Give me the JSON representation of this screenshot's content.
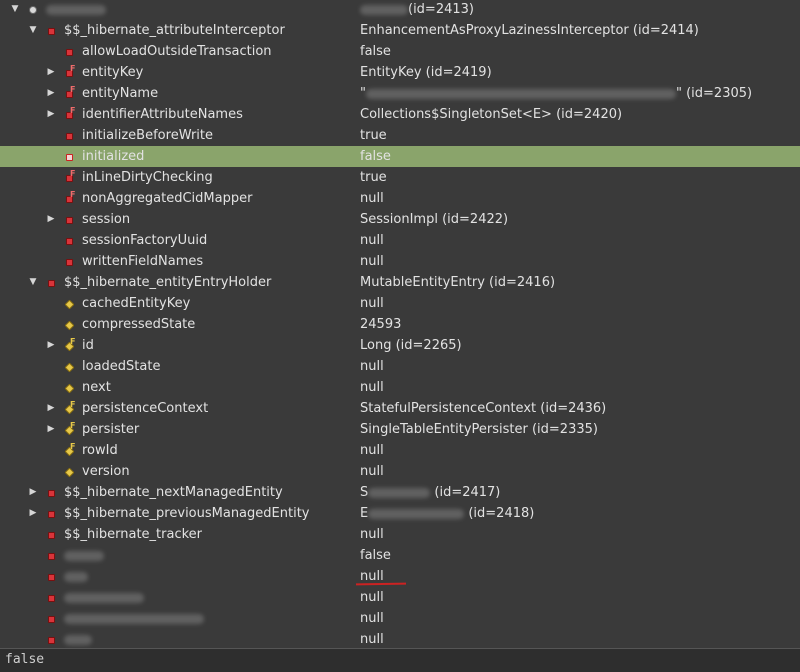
{
  "rows": [
    {
      "indent": 0,
      "arrow": "down",
      "icon": "gray",
      "name": "",
      "name_blur": 60,
      "value": "(id=2413)",
      "value_prefix_blur": 48,
      "selected": false
    },
    {
      "indent": 1,
      "arrow": "down",
      "icon": "red",
      "name": "$$_hibernate_attributeInterceptor",
      "value": "EnhancementAsProxyLazinessInterceptor  (id=2414)"
    },
    {
      "indent": 2,
      "arrow": "none",
      "icon": "red",
      "name": "allowLoadOutsideTransaction",
      "value": "false"
    },
    {
      "indent": 2,
      "arrow": "right",
      "icon": "red-final",
      "name": "entityKey",
      "value": "EntityKey  (id=2419)"
    },
    {
      "indent": 2,
      "arrow": "right",
      "icon": "red-final",
      "name": "entityName",
      "value": "\"",
      "value_blur": 310,
      "value_suffix": "\" (id=2305)"
    },
    {
      "indent": 2,
      "arrow": "right",
      "icon": "red-final",
      "name": "identifierAttributeNames",
      "value": "Collections$SingletonSet<E>  (id=2420)"
    },
    {
      "indent": 2,
      "arrow": "none",
      "icon": "red",
      "name": "initializeBeforeWrite",
      "value": "true"
    },
    {
      "indent": 2,
      "arrow": "none",
      "icon": "hollow",
      "name": "initialized",
      "value": "false",
      "selected": true
    },
    {
      "indent": 2,
      "arrow": "none",
      "icon": "red-final",
      "name": "inLineDirtyChecking",
      "value": "true"
    },
    {
      "indent": 2,
      "arrow": "none",
      "icon": "red-final",
      "name": "nonAggregatedCidMapper",
      "value": "null"
    },
    {
      "indent": 2,
      "arrow": "right",
      "icon": "red",
      "name": "session",
      "value": "SessionImpl  (id=2422)"
    },
    {
      "indent": 2,
      "arrow": "none",
      "icon": "red",
      "name": "sessionFactoryUuid",
      "value": "null"
    },
    {
      "indent": 2,
      "arrow": "none",
      "icon": "red",
      "name": "writtenFieldNames",
      "value": "null"
    },
    {
      "indent": 1,
      "arrow": "down",
      "icon": "red",
      "name": "$$_hibernate_entityEntryHolder",
      "value": "MutableEntityEntry  (id=2416)"
    },
    {
      "indent": 2,
      "arrow": "none",
      "icon": "yellow",
      "name": "cachedEntityKey",
      "value": "null"
    },
    {
      "indent": 2,
      "arrow": "none",
      "icon": "yellow",
      "name": "compressedState",
      "value": "24593"
    },
    {
      "indent": 2,
      "arrow": "right",
      "icon": "yellow-final",
      "name": "id",
      "value": "Long  (id=2265)"
    },
    {
      "indent": 2,
      "arrow": "none",
      "icon": "yellow",
      "name": "loadedState",
      "value": "null"
    },
    {
      "indent": 2,
      "arrow": "none",
      "icon": "yellow",
      "name": "next",
      "value": "null"
    },
    {
      "indent": 2,
      "arrow": "right",
      "icon": "yellow-final",
      "name": "persistenceContext",
      "value": "StatefulPersistenceContext  (id=2436)"
    },
    {
      "indent": 2,
      "arrow": "right",
      "icon": "yellow-final",
      "name": "persister",
      "value": "SingleTableEntityPersister  (id=2335)"
    },
    {
      "indent": 2,
      "arrow": "none",
      "icon": "yellow-final",
      "name": "rowId",
      "value": "null"
    },
    {
      "indent": 2,
      "arrow": "none",
      "icon": "yellow",
      "name": "version",
      "value": "null"
    },
    {
      "indent": 1,
      "arrow": "right",
      "icon": "red",
      "name": "$$_hibernate_nextManagedEntity",
      "value": "S",
      "value_blur": 62,
      "value_suffix": " (id=2417)"
    },
    {
      "indent": 1,
      "arrow": "right",
      "icon": "red",
      "name": "$$_hibernate_previousManagedEntity",
      "value": "E",
      "value_blur": 96,
      "value_suffix": " (id=2418)"
    },
    {
      "indent": 1,
      "arrow": "none",
      "icon": "red",
      "name": "$$_hibernate_tracker",
      "value": "null"
    },
    {
      "indent": 1,
      "arrow": "none",
      "icon": "red",
      "name": "",
      "name_blur": 40,
      "value": "false"
    },
    {
      "indent": 1,
      "arrow": "none",
      "icon": "red",
      "name": "",
      "name_blur": 24,
      "value": "null"
    },
    {
      "indent": 1,
      "arrow": "none",
      "icon": "red",
      "name": "",
      "name_blur": 80,
      "value": "null"
    },
    {
      "indent": 1,
      "arrow": "none",
      "icon": "red",
      "name": "",
      "name_blur": 140,
      "value": "null"
    },
    {
      "indent": 1,
      "arrow": "none",
      "icon": "red",
      "name": "",
      "name_blur": 28,
      "value": "null"
    }
  ],
  "detail_pane": {
    "text": "false"
  },
  "colors": {
    "background": "#3a3a3a",
    "selection": "#8aa46b",
    "text": "#e2e2e2"
  }
}
